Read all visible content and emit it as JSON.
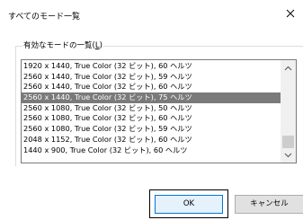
{
  "window": {
    "title": "すべてのモード一覧"
  },
  "group": {
    "label_prefix": "有効なモードの一覧(",
    "label_accel": "L",
    "label_suffix": ")"
  },
  "modes": [
    "1920 x 1440, True Color (32 ビット), 60 ヘルツ",
    "2560 x 1440, True Color (32 ビット), 59 ヘルツ",
    "2560 x 1440, True Color (32 ビット), 60 ヘルツ",
    "2560 x 1440, True Color (32 ビット), 75 ヘルツ",
    "2560 x 1080, True Color (32 ビット), 50 ヘルツ",
    "2560 x 1080, True Color (32 ビット), 60 ヘルツ",
    "2560 x 1080, True Color (32 ビット), 59 ヘルツ",
    "2048 x 1152, True Color (32 ビット), 60 ヘルツ",
    "1440 x 900, True Color (32 ビット), 60 ヘルツ"
  ],
  "selected_index": 3,
  "buttons": {
    "ok": "OK",
    "cancel": "キャンセル"
  }
}
